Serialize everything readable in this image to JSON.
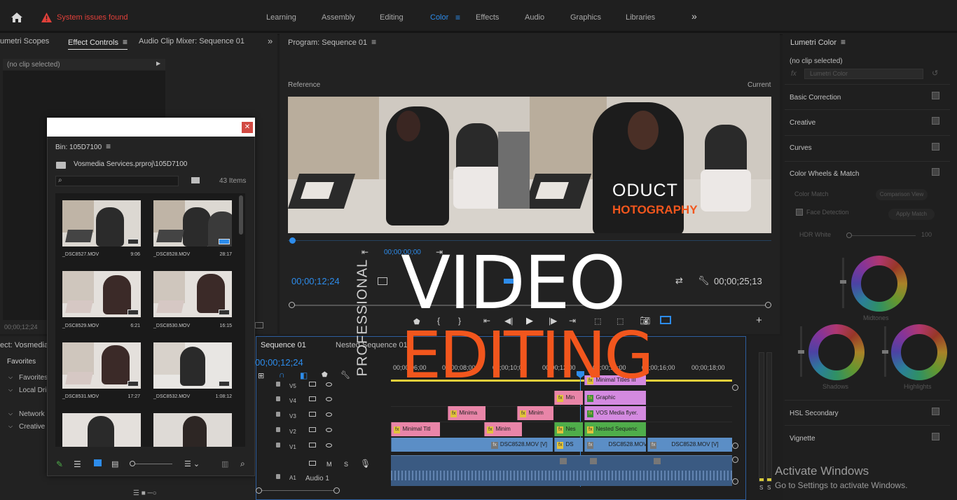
{
  "topbar": {
    "warning": "System issues found",
    "tabs": [
      "Learning",
      "Assembly",
      "Editing",
      "Color",
      "Effects",
      "Audio",
      "Graphics",
      "Libraries"
    ],
    "active_tab": "Color",
    "more": "»"
  },
  "left_panel": {
    "tabs": [
      "umetri Scopes",
      "Effect Controls",
      "Audio Clip Mixer: Sequence 01"
    ],
    "active_tab": "Effect Controls",
    "no_clip": "(no clip selected)",
    "timecode": "00;00;12;24",
    "project_label": "ect: Vosmedia",
    "favorites_tab": "Favorites",
    "tree": [
      "Favorites",
      "Local Dri",
      "Network",
      "Creative"
    ]
  },
  "bin": {
    "title": "Bin: 105D7100",
    "path": "Vosmedia Services.prproj\\105D7100",
    "items_count": "43 Items",
    "search_placeholder": "",
    "thumbnails": [
      {
        "name": "_DSC8527.MOV",
        "dur": "9:06"
      },
      {
        "name": "_DSC8528.MOV",
        "dur": "28:17"
      },
      {
        "name": "_DSC8529.MOV",
        "dur": "6:21"
      },
      {
        "name": "_DSC8530.MOV",
        "dur": "16:15"
      },
      {
        "name": "_DSC8531.MOV",
        "dur": "17:27"
      },
      {
        "name": "_DSC8532.MOV",
        "dur": "1:08:12"
      },
      {
        "name": "",
        "dur": ""
      },
      {
        "name": "",
        "dur": ""
      }
    ]
  },
  "program": {
    "title": "Program: Sequence 01",
    "reference": "Reference",
    "current": "Current",
    "overlay_line1": "ODUCT",
    "overlay_line2": "HOTOGRAPHY",
    "tc_in": "00;00;00;00",
    "tc_left": "00;00;12;24",
    "tc_right": "00;00;25;13"
  },
  "overlay": {
    "vertical": "PROFESSIONAL",
    "big1": "VIDEO",
    "big2": "EDITING"
  },
  "timeline": {
    "tabs": [
      "Sequence 01",
      "Nested Sequence 01"
    ],
    "timecode": "00;00;12;24",
    "ruler": [
      "00;00;06;00",
      "00;00;08;00",
      "00;00;10;00",
      "00;00;12;00",
      "00;00;14;00",
      "00;00;16;00",
      "00;00;18;00"
    ],
    "tracks": [
      "V5",
      "V4",
      "V3",
      "V2",
      "V1",
      "A1"
    ],
    "audio_label": "Audio 1",
    "audio_buttons": [
      "M",
      "S"
    ],
    "clips": {
      "v5": "Minimal Titles III",
      "v4a": "Min",
      "v4b": "Graphic",
      "v3a": "Minima",
      "v3b": "Minim",
      "v3c": "VOS Media flyer.",
      "v2a": "Minimal Titl",
      "v2b": "Minim",
      "v2c": "Nes",
      "v2d": "Nested Sequenc",
      "v1a": "DSC8528.MOV [V]",
      "v1b": "DS",
      "v1c": "DSC8528.MOV [",
      "v1d": "DSC8528.MOV [V]"
    },
    "meter_labels": [
      "S",
      "S"
    ]
  },
  "lumetri": {
    "title": "Lumetri Color",
    "no_clip": "(no clip selected)",
    "fx_dropdown": "Lumetri Color",
    "sections": [
      "Basic Correction",
      "Creative",
      "Curves",
      "Color Wheels & Match"
    ],
    "color_match": "Color Match",
    "comparison_view": "Comparison View",
    "face_detection": "Face Detection",
    "apply_match": "Apply Match",
    "hdr_white": "HDR White",
    "hdr_value": "100",
    "wheels": [
      "Midtones",
      "Shadows",
      "Highlights"
    ],
    "bottom_sections": [
      "HSL Secondary",
      "Vignette"
    ]
  },
  "watermark": {
    "line1": "Activate Windows",
    "line2": "Go to Settings to activate Windows."
  },
  "colors": {
    "accent_blue": "#2d8ceb",
    "warning_red": "#e0403a",
    "overlay_orange": "#f2561d"
  }
}
